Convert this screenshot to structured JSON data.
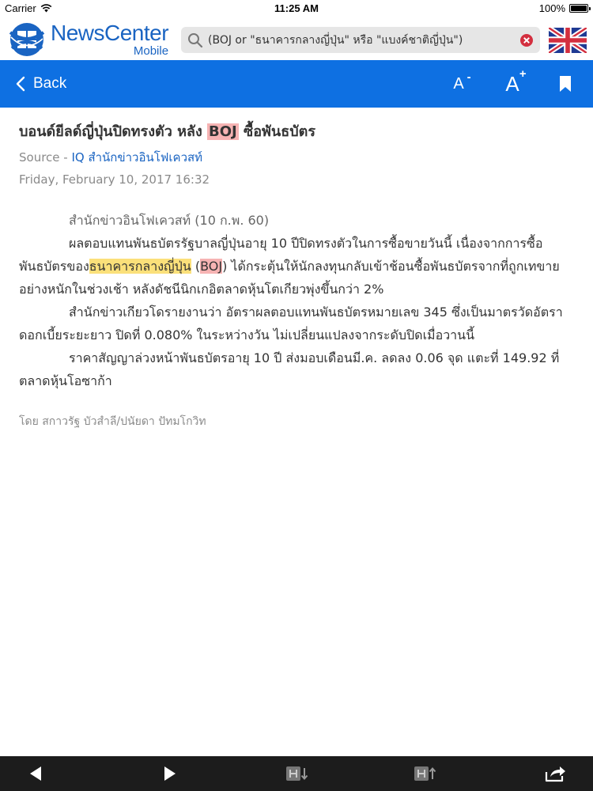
{
  "status_bar": {
    "carrier": "Carrier",
    "time": "11:25 AM",
    "battery": "100%",
    "battery_level": 1.0
  },
  "logo": {
    "title": "NewsCenter",
    "subtitle": "Mobile"
  },
  "search": {
    "value": "(BOJ or \"ธนาคารกลางญี่ปุ่น\" หรือ \"แบงค์ชาติญี่ปุ่น\")"
  },
  "nav": {
    "back_label": "Back",
    "font_decrease": "A",
    "font_increase": "A",
    "minus": "-",
    "plus": "+"
  },
  "article": {
    "headline_before": "บอนด์ยีลด์ญี่ปุ่นปิดทรงตัว หลัง ",
    "headline_highlight": "BOJ",
    "headline_after": " ซื้อพันธบัตร",
    "source_label": "Source - ",
    "source_name": "IQ สำนักข่าวอินโฟเควสท์",
    "date": "Friday, February 10, 2017 16:32",
    "dateline": "สำนักข่าวอินโฟเควสท์ (10 ก.พ. 60)",
    "p1_before": "ผลตอบแทนพันธบัตรรัฐบาลญี่ปุ่นอายุ 10 ปีปิดทรงตัวในการซื้อขายวันนี้ เนื่องจากการซื้อพันธบัตรของ",
    "p1_highlight_yellow": "ธนาคารกลางญี่ปุ่น",
    "p1_paren_open": " (",
    "p1_highlight_pink": "BOJ",
    "p1_after": ") ได้กระตุ้นให้นักลงทุนกลับเข้าช้อนซื้อพันธบัตรจากที่ถูกเทขายอย่างหนักในช่วงเช้า หลังดัชนีนิกเกอิตลาดหุ้นโตเกียวพุ่งขึ้นกว่า 2%",
    "p2": "สำนักข่าวเกียวโดรายงานว่า อัตราผลตอบแทนพันธบัตรหมายเลข 345 ซึ่งเป็นมาตรวัดอัตราดอกเบี้ยระยะยาว ปิดที่ 0.080% ในระหว่างวัน ไม่เปลี่ยนแปลงจากระดับปิดเมื่อวานนี้",
    "p3": "ราคาสัญญาล่วงหน้าพันธบัตรอายุ 10 ปี ส่งมอบเดือนมี.ค. ลดลง 0.06 จุด แตะที่ 149.92 ที่ตลาดหุ้นโอซาก้า",
    "byline": "โดย สกาวรัฐ บัวสำลี/ปนัยดา ปัทมโกวิท"
  },
  "icons": {
    "wifi": "wifi-icon",
    "search": "search-icon",
    "clear": "clear-icon",
    "flag": "uk-flag-icon",
    "back": "chevron-left-icon",
    "bookmark": "bookmark-icon",
    "prev": "triangle-left-icon",
    "next": "triangle-right-icon",
    "share": "share-icon"
  },
  "colors": {
    "nav_blue": "#0e70e2",
    "brand_blue": "#1a64c2",
    "highlight_pink": "#f6b3b3",
    "highlight_yellow": "#fbe07a",
    "toolbar": "#1c1c1c"
  }
}
